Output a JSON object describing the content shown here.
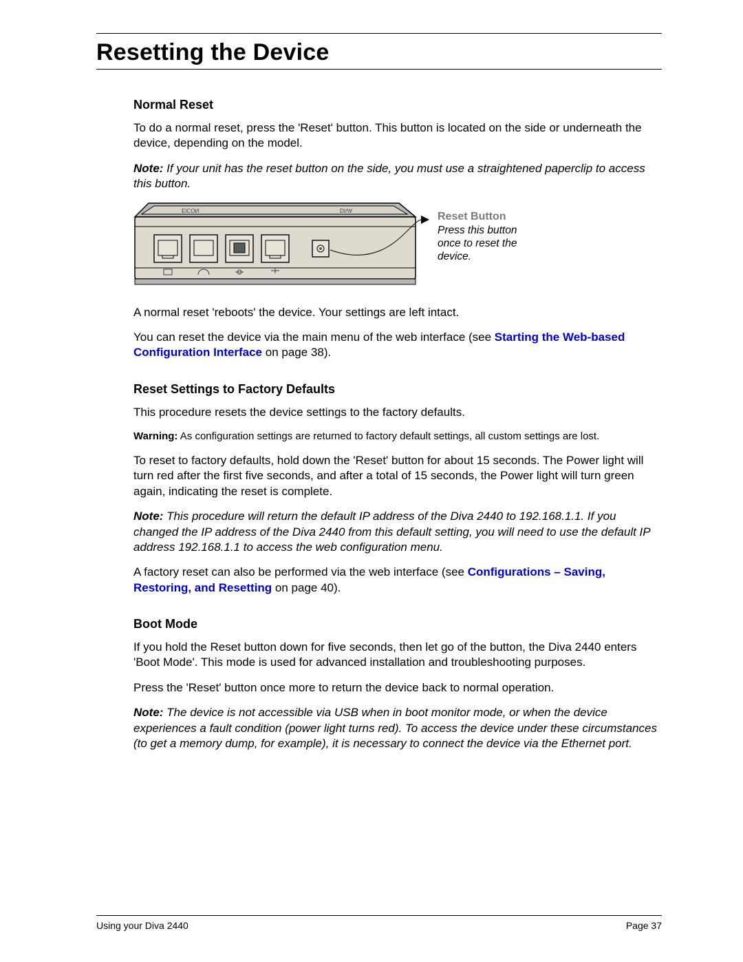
{
  "title": "Resetting the Device",
  "sections": {
    "normal_reset": {
      "heading": "Normal Reset",
      "p1": "To do a normal reset, press the 'Reset' button. This button is located on the side or underneath the device, depending on the model.",
      "note_label": "Note:",
      "note_body": " If your unit has the reset button on the side, you must use a straightened paperclip to access this button.",
      "callout_title": "Reset Button",
      "callout_body": "Press this button once to reset the device.",
      "p2": "A normal reset 'reboots' the device. Your settings are left intact.",
      "p3_prefix": "You can reset the device via the main menu of the web interface (see ",
      "p3_link": "Starting the Web-based Configuration Interface",
      "p3_suffix": " on page 38)."
    },
    "factory": {
      "heading": "Reset Settings to Factory Defaults",
      "p1": "This procedure resets the device settings to the factory defaults.",
      "warn_label": "Warning:",
      "warn_body": "  As configuration settings are returned to factory default settings, all custom settings are lost.",
      "p2": "To reset to factory defaults, hold down the 'Reset' button for about 15 seconds. The Power light will turn red after the first five seconds, and after a total of 15 seconds, the Power light will turn green again, indicating the reset is complete.",
      "note_label": "Note:",
      "note_body": " This procedure will return the default IP address of the Diva 2440 to 192.168.1.1. If you changed the IP address of the Diva 2440 from this default setting, you will need to use the default IP address 192.168.1.1 to access the web configuration menu.",
      "p3_prefix": "A factory reset can also be performed via the web interface (see ",
      "p3_link": "Configurations – Saving, Restoring, and Resetting",
      "p3_suffix": " on page 40)."
    },
    "boot": {
      "heading": "Boot Mode",
      "p1": "If you hold the Reset button down for five seconds, then let go of the button, the Diva 2440 enters 'Boot Mode'. This mode is used for advanced installation and troubleshooting purposes.",
      "p2": "Press the 'Reset' button once more to return the device back to normal operation.",
      "note_label": "Note:",
      "note_body": " The device is not accessible via USB when in boot monitor mode, or when the device experiences a fault condition (power light turns red). To access the device under these circumstances (to get a memory dump, for example), it is necessary to connect the device via the Ethernet port."
    }
  },
  "footer": {
    "left": "Using your Diva 2440",
    "right": "Page 37"
  }
}
